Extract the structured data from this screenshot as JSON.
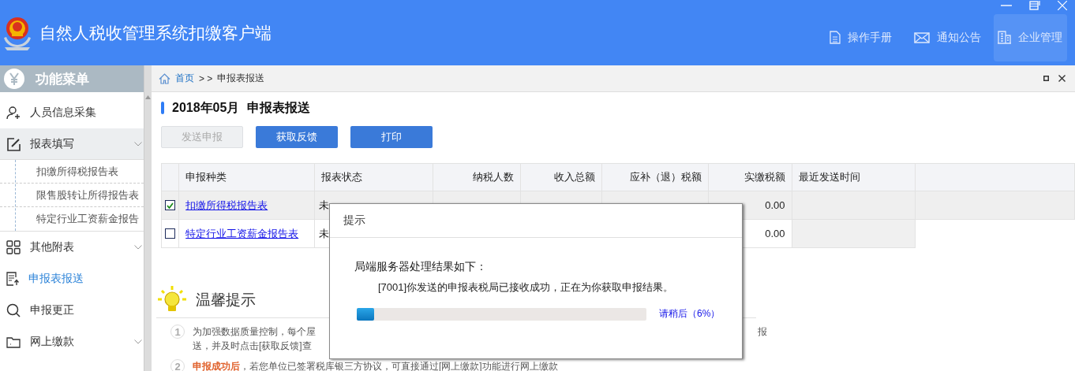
{
  "window": {
    "title": "自然人税收管理系统扣缴客户端"
  },
  "header_nav": [
    {
      "label": "操作手册",
      "selected": false
    },
    {
      "label": "通知公告",
      "selected": false
    },
    {
      "label": "企业管理",
      "selected": true
    }
  ],
  "sidebar": {
    "title": "功能菜单",
    "items": [
      {
        "label": "人员信息采集",
        "kind": "link",
        "selected": false
      },
      {
        "label": "报表填写",
        "kind": "group",
        "expanded": true,
        "selected": false,
        "children": [
          {
            "label": "扣缴所得税报告表",
            "selected": false
          },
          {
            "label": "限售股转让所得报告表",
            "selected": false
          },
          {
            "label": "特定行业工资薪金报告",
            "selected": false
          }
        ]
      },
      {
        "label": "其他附表",
        "kind": "group",
        "expanded": false,
        "selected": false
      },
      {
        "label": "申报表报送",
        "kind": "link",
        "selected": true
      },
      {
        "label": "申报更正",
        "kind": "link",
        "selected": false
      },
      {
        "label": "网上缴款",
        "kind": "group",
        "expanded": false,
        "selected": false
      }
    ]
  },
  "breadcrumb": {
    "home": "首页",
    "separator": "> >",
    "current": "申报表报送"
  },
  "page": {
    "period": "2018年05月",
    "title": "申报表报送",
    "buttons": [
      {
        "label": "发送申报",
        "disabled": true
      },
      {
        "label": "获取反馈",
        "disabled": false
      },
      {
        "label": "打印",
        "disabled": false
      }
    ]
  },
  "table": {
    "columns": [
      "申报种类",
      "报表状态",
      "纳税人数",
      "收入总额",
      "应补（退）税额",
      "实缴税额",
      "最近发送时间"
    ],
    "rows": [
      {
        "checked": true,
        "selected": true,
        "report_type": "扣缴所得税报告表",
        "status": "未",
        "paid_tax": "0.00"
      },
      {
        "checked": false,
        "selected": false,
        "report_type": "特定行业工资薪金报告表",
        "status": "未",
        "paid_tax": "0.00"
      }
    ]
  },
  "tips": {
    "title": "温馨提示",
    "items": [
      {
        "number": "1",
        "lines": [
          "为加强数据质量控制，每个屋",
          "送，并及时点击[获取反馈]查"
        ],
        "tail": "报"
      },
      {
        "number": "2",
        "text": "**申报成功后**，若您单位已签署税库银三方协议，可直接通过[网上缴款]功能进行网上缴款"
      }
    ]
  },
  "dialog": {
    "title": "提示",
    "heading": "局端服务器处理结果如下：",
    "message": "[7001]你发送的申报表税局已接收成功，正在为你获取申报结果。",
    "progress": {
      "level": 0.06,
      "label": "请稍后（6%）"
    }
  }
}
